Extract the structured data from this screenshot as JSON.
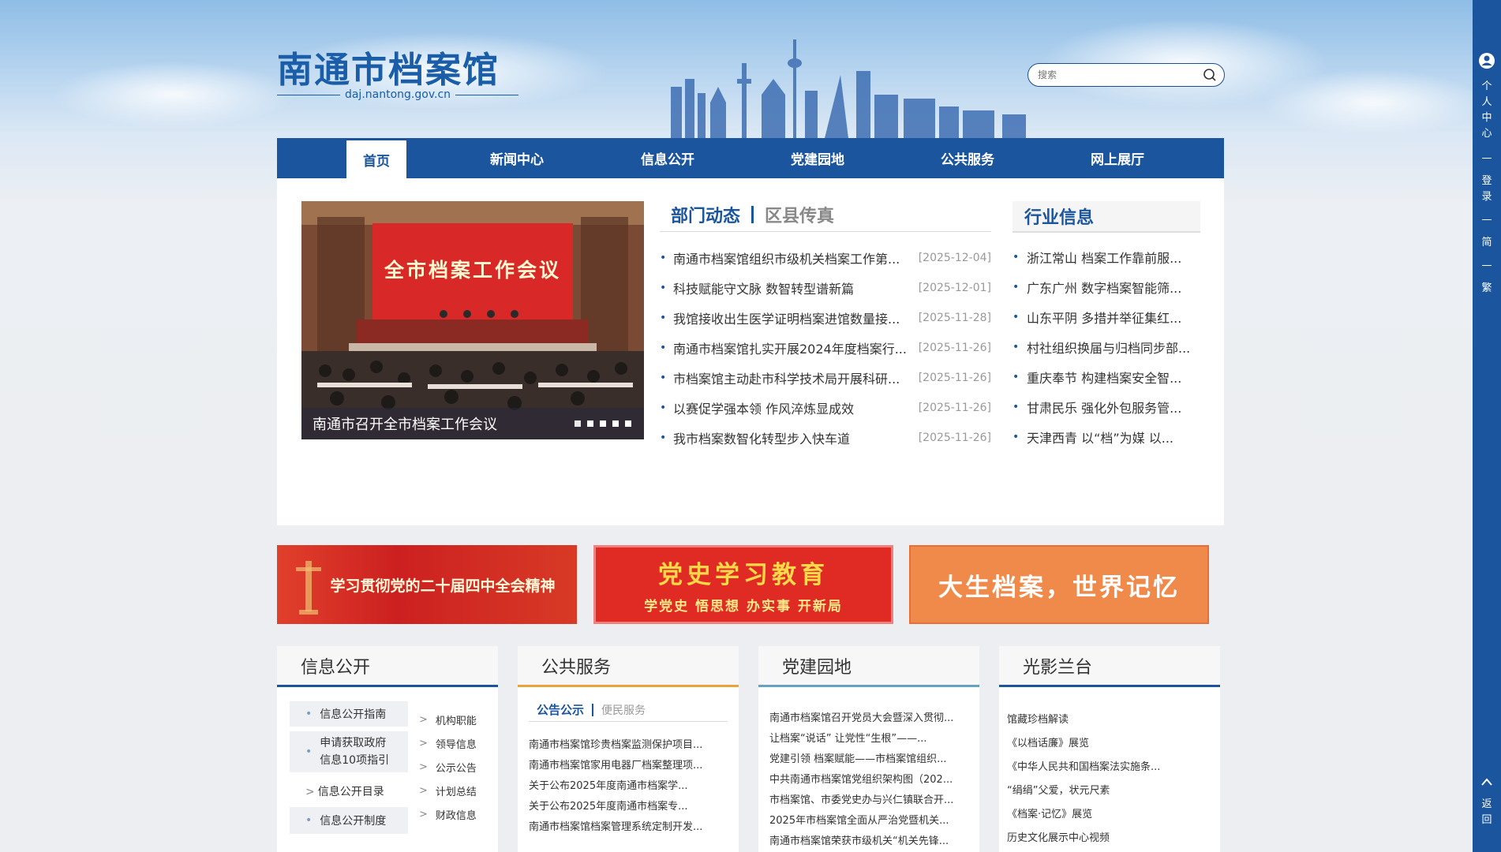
{
  "header": {
    "title": "南通市档案馆",
    "domain": "daj.nantong.gov.cn",
    "search_placeholder": "搜索"
  },
  "nav": {
    "items": [
      "首页",
      "新闻中心",
      "信息公开",
      "党建园地",
      "公共服务",
      "网上展厅"
    ],
    "active_index": 0
  },
  "slideshow": {
    "banner_text": "全市档案工作会议",
    "caption": "南通市召开全市档案工作会议",
    "dots": 5
  },
  "news": {
    "tabs": [
      "部门动态",
      "区县传真"
    ],
    "active_tab": 0,
    "items": [
      {
        "title": "南通市档案馆组织市级机关档案工作第...",
        "date": "[2025-12-04]"
      },
      {
        "title": "科技赋能守文脉 数智转型谱新篇",
        "date": "[2025-12-01]"
      },
      {
        "title": "我馆接收出生医学证明档案进馆数量接...",
        "date": "[2025-11-28]"
      },
      {
        "title": "南通市档案馆扎实开展2024年度档案行...",
        "date": "[2025-11-26]"
      },
      {
        "title": "市档案馆主动赴市科学技术局开展科研...",
        "date": "[2025-11-26]"
      },
      {
        "title": "以赛促学强本领 作风淬炼显成效",
        "date": "[2025-11-26]"
      },
      {
        "title": "我市档案数智化转型步入快车道",
        "date": "[2025-11-26]"
      }
    ]
  },
  "industry": {
    "title": "行业信息",
    "items": [
      "浙江常山 档案工作靠前服...",
      "广东广州 数字档案智能筛...",
      "山东平阴 多措并举征集红...",
      "村社组织换届与归档同步部...",
      "重庆奉节 构建档案安全智...",
      "甘肃民乐 强化外包服务管...",
      "天津西青 以“档”为媒 以..."
    ]
  },
  "banners": {
    "b1": "学习贯彻党的二十届四中全会精神",
    "b2_title": "党史学习教育",
    "b2_sub": "学党史 悟思想 办实事 开新局",
    "b3": "大生档案，世界记忆"
  },
  "columns": {
    "info_public": {
      "title": "信息公开",
      "guide": "信息公开指南",
      "apply_line1": "申请获取政府",
      "apply_line2": "信息10项指引",
      "catalog": "信息公开目录",
      "system": "信息公开制度",
      "links": [
        "机构职能",
        "领导信息",
        "公示公告",
        "计划总结",
        "财政信息"
      ]
    },
    "public_service": {
      "title": "公共服务",
      "tabs": [
        "公告公示",
        "便民服务"
      ],
      "items": [
        "南通市档案馆珍贵档案监测保护项目...",
        "南通市档案馆家用电器厂档案整理项...",
        "关于公布2025年度南通市档案学...",
        "关于公布2025年度南通市档案专...",
        "南通市档案馆档案管理系统定制开发..."
      ]
    },
    "party": {
      "title": "党建园地",
      "items": [
        "南通市档案馆召开党员大会暨深入贯彻...",
        "让档案“说话” 让党性“生根”——...",
        "党建引领 档案赋能——市档案馆组织...",
        "中共南通市档案馆党组织架构图（202...",
        "市档案馆、市委党史办与兴仁镇联合开...",
        "2025年市档案馆全面从严治党暨机关...",
        "南通市档案馆荣获市级机关“机关先锋..."
      ]
    },
    "gallery": {
      "title": "光影兰台",
      "items": [
        "馆藏珍档解读",
        "《以档话廉》展览",
        "《中华人民共和国档案法实施条...",
        "“绢绢”父爱，状元尺素",
        "《档案·记忆》展览",
        "历史文化展示中心视频"
      ]
    }
  },
  "sidebar": {
    "personal": "个人中心",
    "login": "登录",
    "simplified": "简",
    "traditional": "繁",
    "back_top": "返回"
  }
}
